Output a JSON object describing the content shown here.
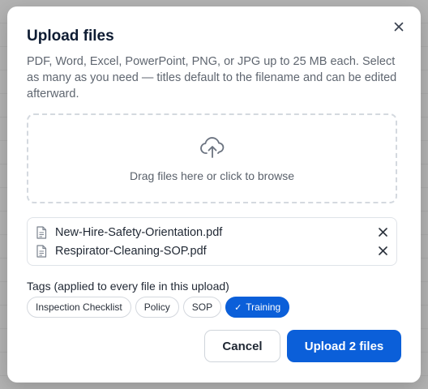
{
  "dialog": {
    "title": "Upload files",
    "description": "PDF, Word, Excel, PowerPoint, PNG, or JPG up to 25 MB each. Select as many as you need — titles default to the filename and can be edited afterward."
  },
  "dropzone": {
    "text": "Drag files here or click to browse",
    "icon": "cloud-upload-icon"
  },
  "files": [
    {
      "name": "New-Hire-Safety-Orientation.pdf"
    },
    {
      "name": "Respirator-Cleaning-SOP.pdf"
    }
  ],
  "tags": {
    "label": "Tags (applied to every file in this upload)",
    "items": [
      {
        "label": "Inspection Checklist",
        "selected": false
      },
      {
        "label": "Policy",
        "selected": false
      },
      {
        "label": "SOP",
        "selected": false
      },
      {
        "label": "Training",
        "selected": true
      }
    ]
  },
  "actions": {
    "cancel_label": "Cancel",
    "upload_label": "Upload 2 files"
  },
  "colors": {
    "primary": "#0b5fd9",
    "title": "#0e1c33",
    "muted_text": "#5f6670"
  }
}
